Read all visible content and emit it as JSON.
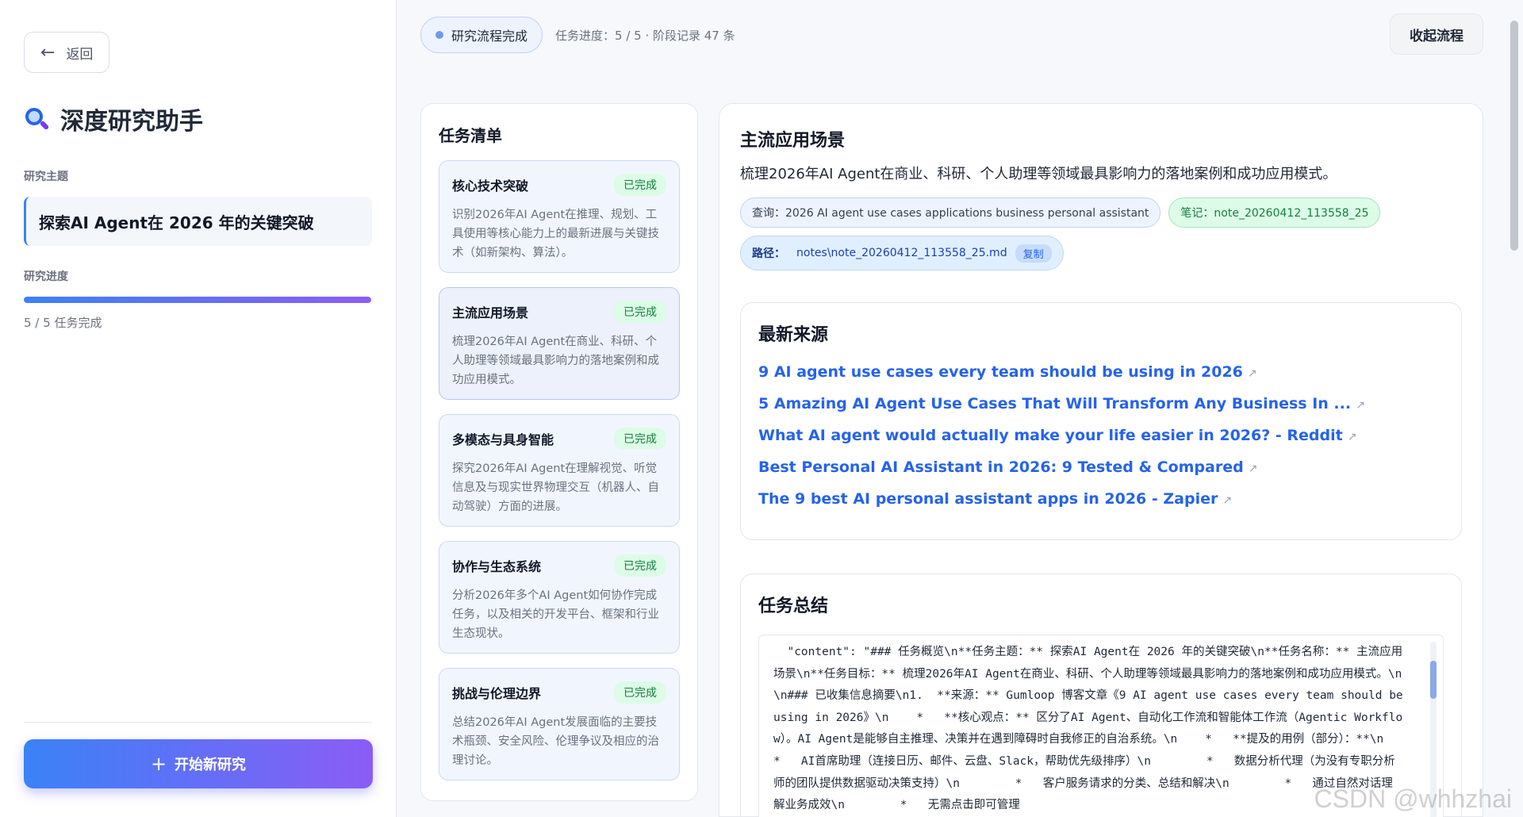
{
  "sidebar": {
    "back_label": "返回",
    "app_title": "深度研究助手",
    "topic_label": "研究主题",
    "topic_value": "探索AI Agent在 2026 年的关键突破",
    "progress_label": "研究进度",
    "progress_fraction": 1.0,
    "progress_text": "5 / 5 任务完成",
    "new_research_label": "开始新研究"
  },
  "topbar": {
    "status_label": "研究流程完成",
    "meta_text": "任务进度：5 / 5 · 阶段记录 47 条",
    "collapse_label": "收起流程"
  },
  "tasks": {
    "title": "任务清单",
    "items": [
      {
        "name": "核心技术突破",
        "status": "已完成",
        "desc": "识别2026年AI Agent在推理、规划、工具使用等核心能力上的最新进展与关键技术（如新架构、算法）。"
      },
      {
        "name": "主流应用场景",
        "status": "已完成",
        "desc": "梳理2026年AI Agent在商业、科研、个人助理等领域最具影响力的落地案例和成功应用模式。"
      },
      {
        "name": "多模态与具身智能",
        "status": "已完成",
        "desc": "探究2026年AI Agent在理解视觉、听觉信息及与现实世界物理交互（机器人、自动驾驶）方面的进展。"
      },
      {
        "name": "协作与生态系统",
        "status": "已完成",
        "desc": "分析2026年多个AI Agent如何协作完成任务，以及相关的开发平台、框架和行业生态现状。"
      },
      {
        "name": "挑战与伦理边界",
        "status": "已完成",
        "desc": "总结2026年AI Agent发展面临的主要技术瓶颈、安全风险、伦理争议及相应的治理讨论。"
      }
    ]
  },
  "detail": {
    "title": "主流应用场景",
    "desc": "梳理2026年AI Agent在商业、科研、个人助理等领域最具影响力的落地案例和成功应用模式。",
    "query_tag": "查询：2026 AI agent use cases applications business personal assistant",
    "note_tag": "笔记：note_20260412_113558_25",
    "path_key": "路径：",
    "path_value": "notes\\note_20260412_113558_25.md",
    "copy_label": "复制",
    "sources_title": "最新来源",
    "sources": [
      "9 AI agent use cases every team should be using in 2026",
      "5 Amazing AI Agent Use Cases That Will Transform Any Business In ...",
      "What AI agent would actually make your life easier in 2026? - Reddit",
      "Best Personal AI Assistant in 2026: 9 Tested & Compared",
      "The 9 best AI personal assistant apps in 2026 - Zapier"
    ],
    "external_icon": "↗",
    "summary_title": "任务总结",
    "summary_text": "  \"content\": \"### 任务概览\\n**任务主题：** 探索AI Agent在 2026 年的关键突破\\n**任务名称：** 主流应用场景\\n**任务目标：** 梳理2026年AI Agent在商业、科研、个人助理等领域最具影响力的落地案例和成功应用模式。\\n\\n### 已收集信息摘要\\n1.  **来源：** Gumloop 博客文章《9 AI agent use cases every team should be using in 2026》\\n    *   **核心观点：** 区分了AI Agent、自动化工作流和智能体工作流（Agentic Workflow）。AI Agent是能够自主推理、决策并在遇到障碍时自我修正的自治系统。\\n    *   **提及的用例（部分）：**\\n        *   AI首席助理（连接日历、邮件、云盘、Slack，帮助优先级排序）\\n        *   数据分析代理（为没有专职分析师的团队提供数据驱动决策支持）\\n        *   客户服务请求的分类、总结和解决\\n        *   通过自然对话理解业务成效\\n        *   无需点击即可管理"
  },
  "watermark": "CSDN @whhzhai",
  "colors": {
    "accent_blue": "#3b82f6",
    "accent_purple": "#8b5cf6",
    "done_green": "#15803d",
    "link_blue": "#2563eb"
  }
}
